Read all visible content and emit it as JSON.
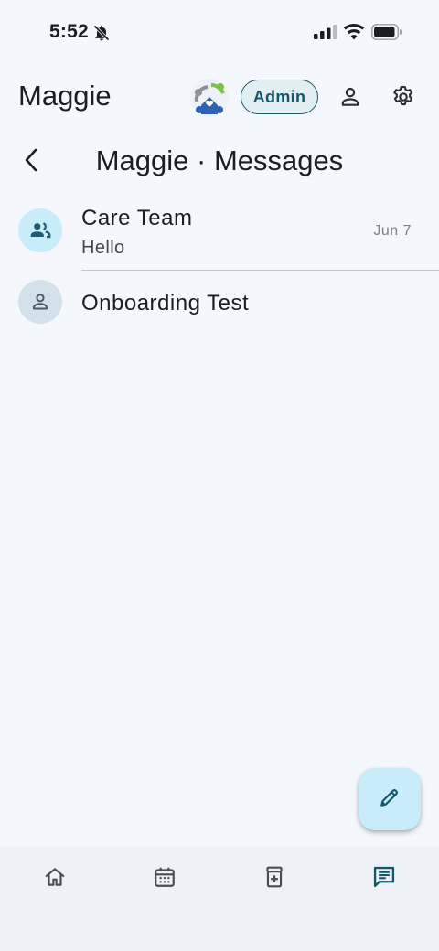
{
  "status_bar": {
    "time": "5:52",
    "icons": [
      "bell-off-icon",
      "signal-icon",
      "wifi-icon",
      "battery-icon"
    ]
  },
  "header": {
    "title": "Maggie",
    "role_chip": "Admin",
    "icons": [
      "app-logo",
      "profile-icon",
      "settings-icon"
    ]
  },
  "sub_header": {
    "title": "Maggie · Messages",
    "back_icon": "chevron-left-icon"
  },
  "threads": [
    {
      "name": "Care Team",
      "preview": "Hello",
      "date": "Jun 7",
      "avatar_icon": "group-icon"
    },
    {
      "name": "Onboarding Test",
      "preview": "",
      "date": "",
      "avatar_icon": "person-icon"
    }
  ],
  "fab": {
    "icon": "pencil-icon"
  },
  "bottom_nav": {
    "items": [
      {
        "icon": "home-icon",
        "active": false
      },
      {
        "icon": "calendar-icon",
        "active": false
      },
      {
        "icon": "medication-icon",
        "active": false
      },
      {
        "icon": "messages-icon",
        "active": true
      }
    ]
  },
  "colors": {
    "background": "#f4f7fb",
    "accent": "#14566a",
    "chip_bg": "#e1eef2",
    "avatar_group_bg": "#c9ecfb",
    "avatar_person_bg": "#d3e1ea",
    "nav_bg": "#eef2f7"
  }
}
